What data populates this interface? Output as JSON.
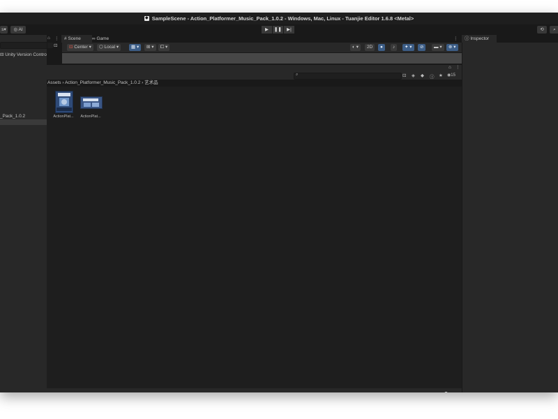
{
  "window": {
    "title": "SampleScene - Action_Platformer_Music_Pack_1.0.2 - Windows, Mac, Linux - Tuanjie Editor 1.6.8 <Metal>"
  },
  "toolbar": {
    "left_dropdown_label": "s",
    "ai_label": "AI",
    "play_icon": "play-icon",
    "pause_icon": "pause-icon",
    "step_icon": "step-icon",
    "history_icon": "history-icon"
  },
  "left_panel": {
    "version_control_label": "Unity Version Control",
    "package_label": "_Pack_1.0.2"
  },
  "scene_panel": {
    "tabs": [
      {
        "label": "Scene",
        "icon": "scene-icon"
      },
      {
        "label": "Game",
        "icon": "game-icon"
      }
    ],
    "tools": {
      "pivot": "Center",
      "space": "Local",
      "mode_2d": "2D"
    }
  },
  "project_panel": {
    "breadcrumb": [
      "Assets",
      "Action_Platformer_Music_Pack_1.0.2",
      "艺术品"
    ],
    "visible_count": "15",
    "assets": [
      {
        "label": "ActionPlat..."
      },
      {
        "label": "ActionPlat..."
      }
    ]
  },
  "inspector": {
    "tab_label": "Inspector"
  },
  "colors": {
    "background": "#191919",
    "panel": "#282828",
    "accent": "#3c5d86"
  }
}
